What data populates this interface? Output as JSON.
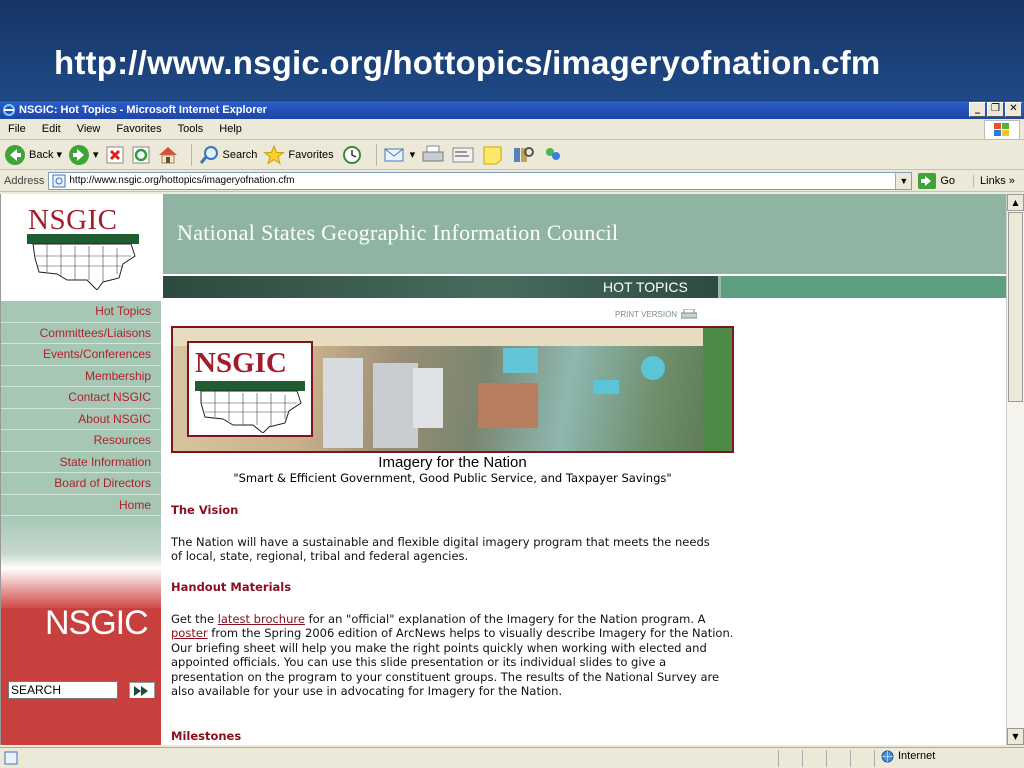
{
  "slide": {
    "title": "http://www.nsgic.org/hottopics/imageryofnation.cfm"
  },
  "window": {
    "title": "NSGIC: Hot Topics - Microsoft Internet Explorer",
    "menu": [
      "File",
      "Edit",
      "View",
      "Favorites",
      "Tools",
      "Help"
    ],
    "toolbar": {
      "back": "Back",
      "search": "Search",
      "favorites": "Favorites"
    },
    "address": {
      "label": "Address",
      "url": "http://www.nsgic.org/hottopics/imageryofnation.cfm",
      "go": "Go",
      "links": "Links"
    },
    "status": {
      "zone": "Internet"
    }
  },
  "page": {
    "logo_text": "NSGIC",
    "header_title": "National States Geographic Information Council",
    "hot_topics": "HOT TOPICS",
    "print_version": "PRINT VERSION",
    "nav": [
      "Hot Topics",
      "Committees/Liaisons",
      "Events/Conferences",
      "Membership",
      "Contact NSGIC",
      "About NSGIC",
      "Resources",
      "State Information",
      "Board of Directors",
      "Home"
    ],
    "nav_brand": "NSGIC",
    "search_value": "SEARCH",
    "banner_logo": "NSGIC",
    "banner_title": "Imagery for the Nation",
    "banner_subtitle": "\"Smart & Efficient Government, Good Public Service, and Taxpayer Savings\"",
    "vision_head": "The Vision",
    "vision_text": "The Nation will have a sustainable and flexible digital imagery program that meets the needs of local, state, regional, tribal and federal agencies.",
    "handout_head": "Handout Materials",
    "handout": {
      "t1": "Get the ",
      "link1": "latest brochure",
      "t2": " for an \"official\" explanation of the Imagery for the Nation program. A ",
      "link2": "poster",
      "t3": " from the Spring 2006 edition of ArcNews helps to visually describe Imagery for the Nation. Our briefing sheet will help you make the right points quickly when working with elected and appointed officials. You can use this slide presentation or its individual slides to give a presentation on the program to your constituent groups. The results of the National Survey are also available for your use in advocating for Imagery for the Nation."
    },
    "milestones_head": "Milestones"
  }
}
